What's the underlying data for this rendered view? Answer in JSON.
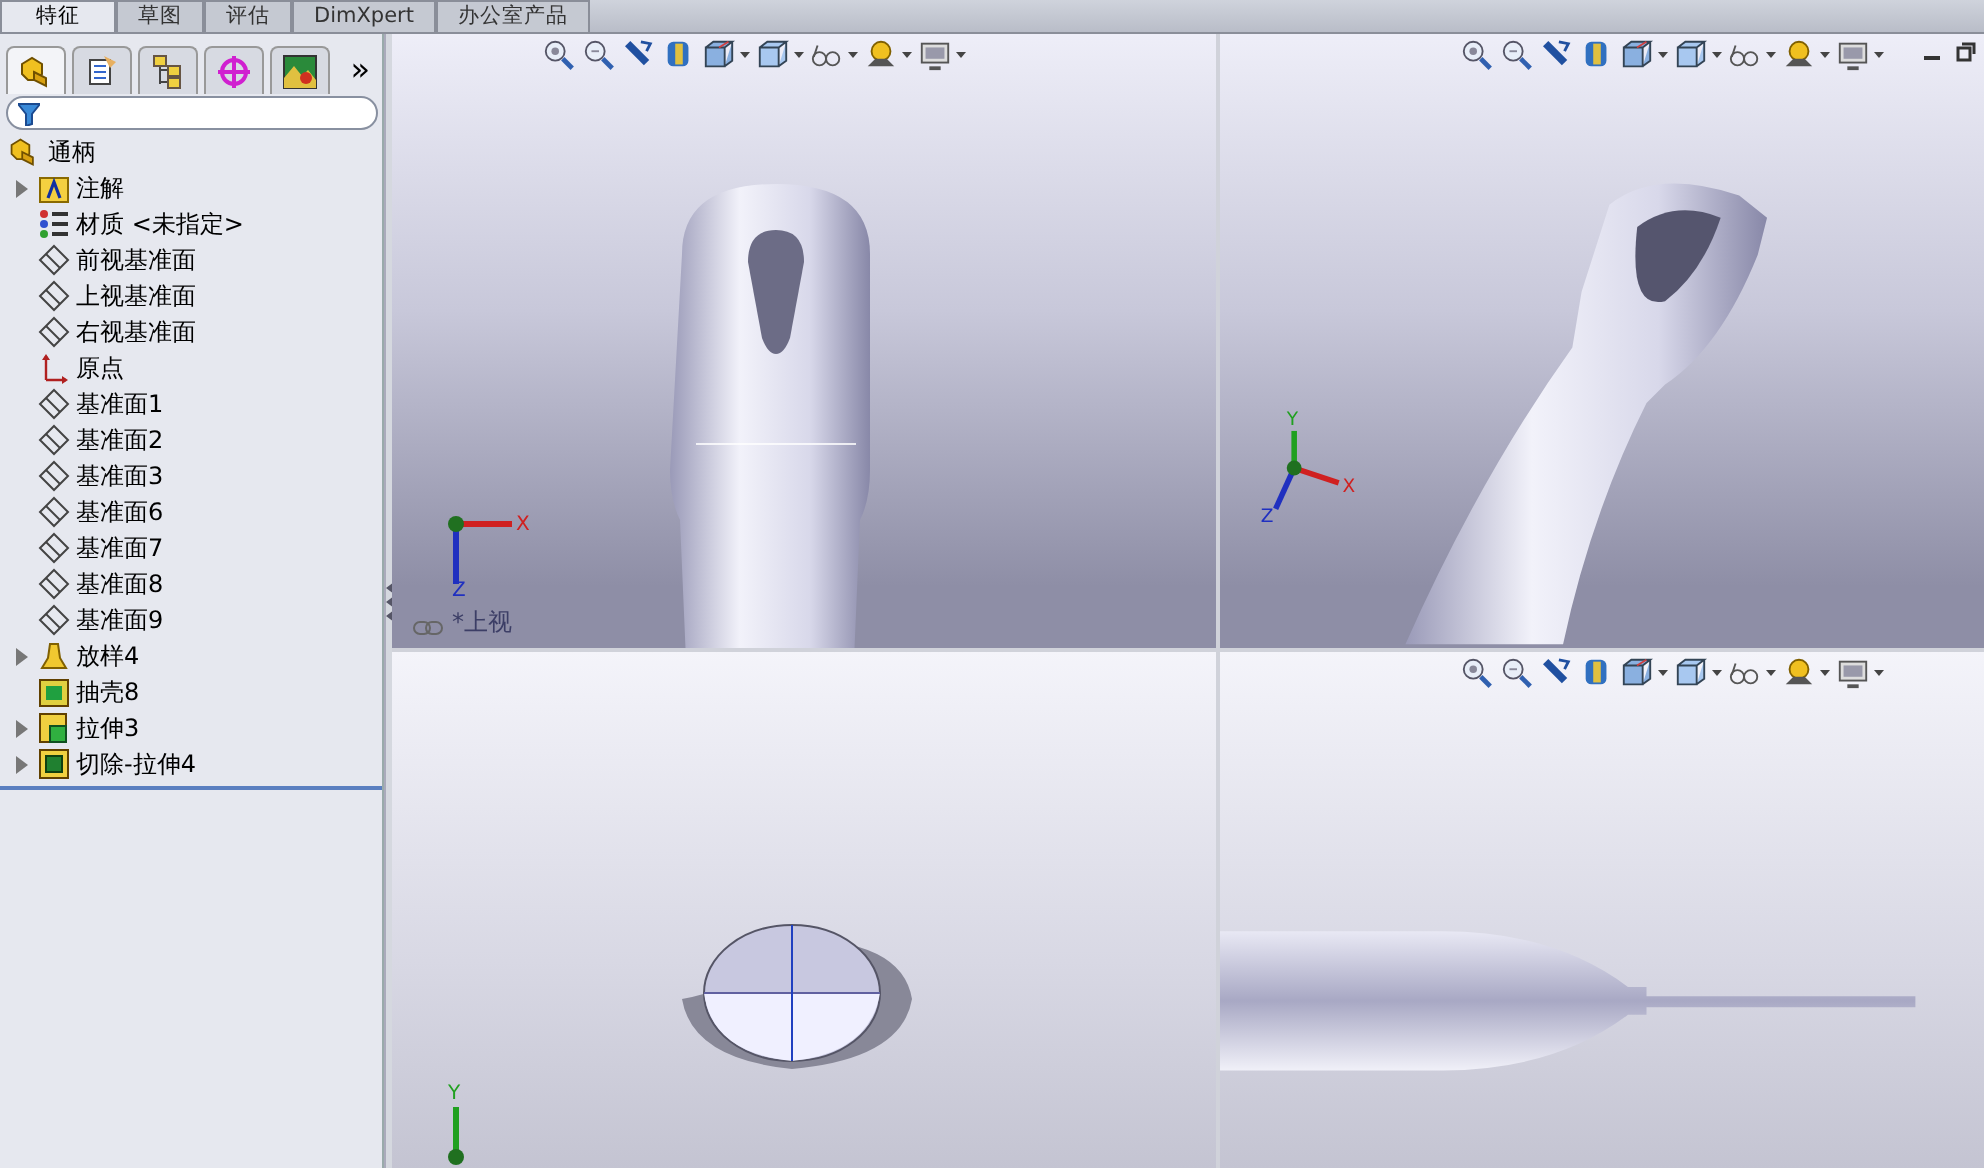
{
  "command_tabs": [
    {
      "label": "特征",
      "selected": true
    },
    {
      "label": "草图",
      "selected": false
    },
    {
      "label": "评估",
      "selected": false
    },
    {
      "label": "DimXpert",
      "selected": false
    },
    {
      "label": "办公室产品",
      "selected": false
    }
  ],
  "panel_tabs": [
    {
      "kind": "feature",
      "selected": true
    },
    {
      "kind": "property",
      "selected": false
    },
    {
      "kind": "config",
      "selected": false
    },
    {
      "kind": "dimxpert",
      "selected": false
    },
    {
      "kind": "display",
      "selected": false
    }
  ],
  "panel_more": "»",
  "tree": {
    "root": "通柄",
    "items": [
      {
        "kind": "annotation",
        "label": "注解",
        "expander": true
      },
      {
        "kind": "material",
        "label": "材质 <未指定>",
        "expander": false
      },
      {
        "kind": "plane",
        "label": "前视基准面",
        "expander": false
      },
      {
        "kind": "plane",
        "label": "上视基准面",
        "expander": false
      },
      {
        "kind": "plane",
        "label": "右视基准面",
        "expander": false
      },
      {
        "kind": "origin",
        "label": "原点",
        "expander": false
      },
      {
        "kind": "plane",
        "label": "基准面1",
        "expander": false
      },
      {
        "kind": "plane",
        "label": "基准面2",
        "expander": false
      },
      {
        "kind": "plane",
        "label": "基准面3",
        "expander": false
      },
      {
        "kind": "plane",
        "label": "基准面6",
        "expander": false
      },
      {
        "kind": "plane",
        "label": "基准面7",
        "expander": false
      },
      {
        "kind": "plane",
        "label": "基准面8",
        "expander": false
      },
      {
        "kind": "plane",
        "label": "基准面9",
        "expander": false
      },
      {
        "kind": "loft",
        "label": "放样4",
        "expander": true
      },
      {
        "kind": "shell",
        "label": "抽壳8",
        "expander": false
      },
      {
        "kind": "extrude",
        "label": "拉伸3",
        "expander": true
      },
      {
        "kind": "cut",
        "label": "切除-拉伸4",
        "expander": true
      }
    ]
  },
  "viewports": [
    {
      "kind": "top",
      "toolbar": true,
      "window_controls": false,
      "view_label": "*上视",
      "triad_labels": [
        "X",
        "Z"
      ]
    },
    {
      "kind": "iso",
      "toolbar": true,
      "window_controls": true,
      "triad_labels": [
        "Y",
        "X",
        "Z"
      ]
    },
    {
      "kind": "section",
      "toolbar": false,
      "window_controls": false,
      "triad_labels": [
        "Y"
      ]
    },
    {
      "kind": "side",
      "toolbar": true,
      "window_controls": false
    }
  ]
}
